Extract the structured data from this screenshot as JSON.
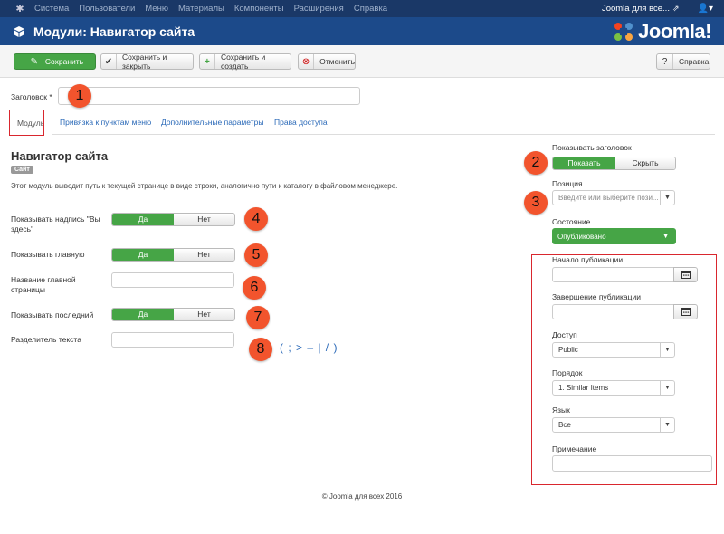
{
  "topnav": {
    "items": [
      "Система",
      "Пользователи",
      "Меню",
      "Материалы",
      "Компоненты",
      "Расширения",
      "Справка"
    ],
    "site_name": "Joomla для все...",
    "external_icon": "external-link-icon",
    "user_icon": "user-icon"
  },
  "header": {
    "title": "Модули: Навигатор сайта",
    "brand": "Joomla!"
  },
  "toolbar": {
    "save": "Сохранить",
    "save_close": "Сохранить и закрыть",
    "save_new": "Сохранить и создать",
    "cancel": "Отменить",
    "help": "Справка"
  },
  "title_field": {
    "label": "Заголовок *",
    "value": ""
  },
  "tabs": [
    "Модуль",
    "Привязка к пунктам меню",
    "Дополнительные параметры",
    "Права доступа"
  ],
  "module": {
    "name": "Навигатор сайта",
    "badge": "Сайт",
    "description": "Этот модуль выводит путь к текущей странице в виде строки, аналогично пути к каталогу в файловом менеджере."
  },
  "fields": {
    "show_here_label": "Показывать надпись \"Вы здесь\"",
    "show_home_label": "Показывать главную",
    "home_name_label": "Название главной страницы",
    "show_last_label": "Показывать последний",
    "separator_label": "Разделитель текста",
    "yes": "Да",
    "no": "Нет"
  },
  "separator_hint": "( ; > – | / )",
  "markers": [
    "1",
    "2",
    "3",
    "4",
    "5",
    "6",
    "7",
    "8"
  ],
  "right": {
    "show_title_label": "Показывать заголовок",
    "show": "Показать",
    "hide": "Скрыть",
    "position_label": "Позиция",
    "position_placeholder": "Введите или выберите пози...",
    "state_label": "Состояние",
    "state_value": "Опубликовано",
    "publish_up_label": "Начало публикации",
    "publish_down_label": "Завершение публикации",
    "access_label": "Доступ",
    "access_value": "Public",
    "ordering_label": "Порядок",
    "ordering_value": "1. Similar Items",
    "language_label": "Язык",
    "language_value": "Все",
    "note_label": "Примечание"
  },
  "footer": "© Joomla для всех 2016",
  "colors": {
    "topnav_bg": "#1a3867",
    "header_bg": "#1c4a8a",
    "success": "#46a546",
    "marker": "#f2542d",
    "highlight_frame": "#d9272e"
  }
}
